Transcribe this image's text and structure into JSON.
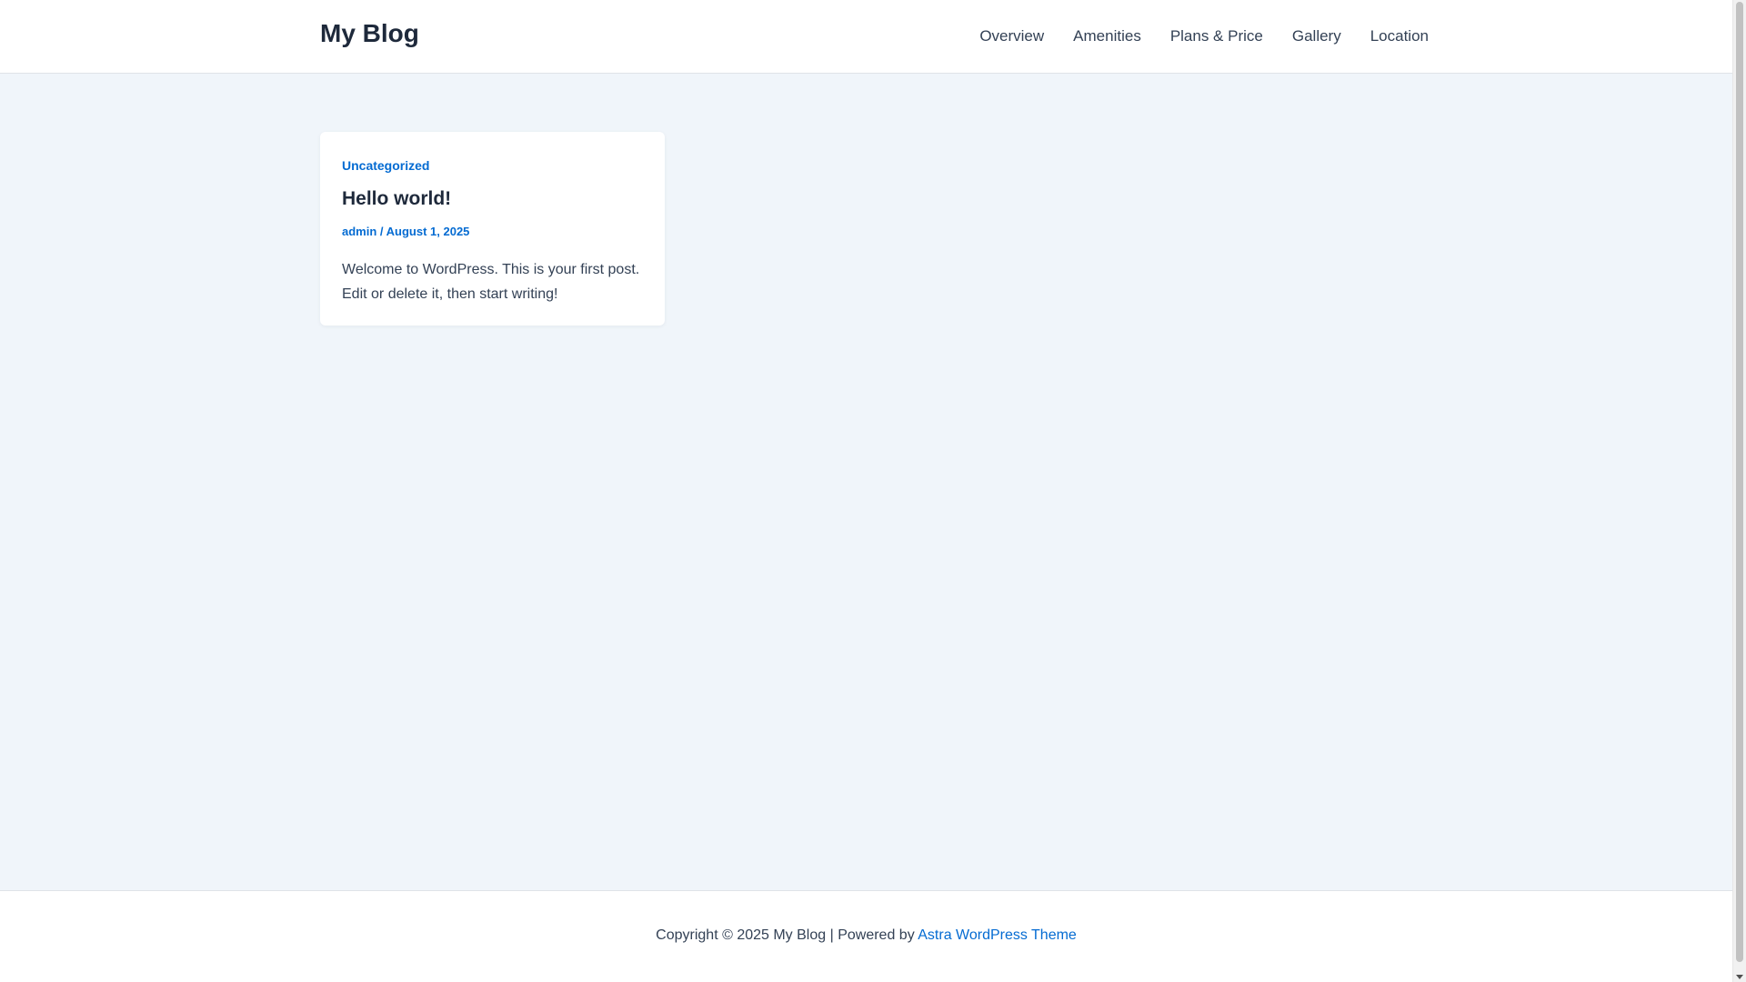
{
  "header": {
    "site_title": "My Blog",
    "nav": [
      {
        "label": "Overview"
      },
      {
        "label": "Amenities"
      },
      {
        "label": "Plans & Price"
      },
      {
        "label": "Gallery"
      },
      {
        "label": "Location"
      }
    ]
  },
  "post": {
    "category": "Uncategorized",
    "title": "Hello world!",
    "author": "admin",
    "separator": " / ",
    "date": "August 1, 2025",
    "excerpt": "Welcome to WordPress. This is your first post. Edit or delete it, then start writing!"
  },
  "footer": {
    "copyright": "Copyright © 2025 My Blog | Powered by ",
    "theme_link": "Astra WordPress Theme"
  },
  "colors": {
    "accent": "#046bd2",
    "heading": "#1e293b",
    "text": "#334155",
    "background": "#f0f5fa"
  }
}
